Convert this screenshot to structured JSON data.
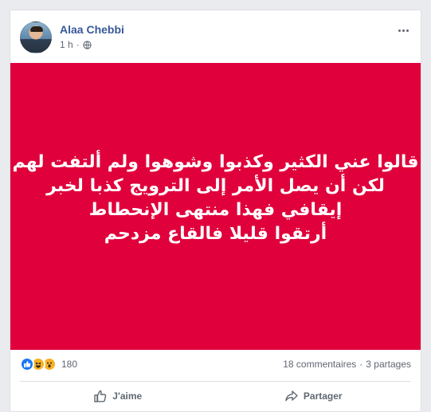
{
  "post": {
    "author": "Alaa Chebbi",
    "time": "1 h",
    "separator": "·",
    "privacy_icon": "globe-icon",
    "background_color": "#e0003b",
    "text_lines": [
      "قالوا عني الكثير وكذبوا وشوهوا ولم ألتفت لهم",
      "لكن أن يصل الأمر إلى الترويج كذبا لخبر",
      "إيقافي فهذا منتهى الإنحطاط",
      "أرتقوا قليلا فالقاع مزدحم"
    ]
  },
  "stats": {
    "reaction_icons": [
      "like-icon",
      "haha-icon",
      "wow-icon"
    ],
    "reaction_count": "180",
    "comments": "18 commentaires",
    "separator": "·",
    "shares": "3 partages"
  },
  "actions": {
    "like_label": "J'aime",
    "share_label": "Partager"
  },
  "colors": {
    "author_link": "#385898",
    "like_blue": "#1877f2"
  }
}
